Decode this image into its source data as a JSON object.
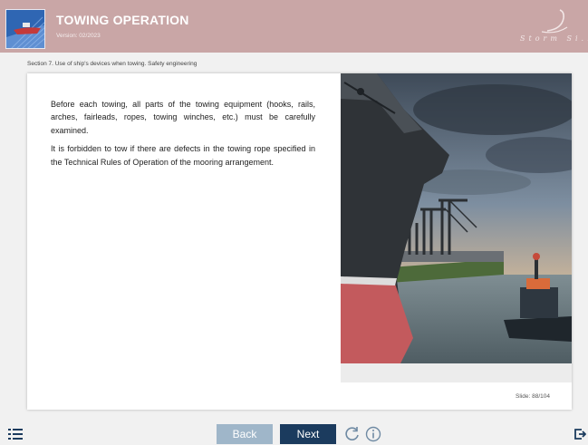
{
  "header": {
    "title": "TOWING OPERATION",
    "version": "Version: 02/2023",
    "brand_text": "Storm Si..."
  },
  "breadcrumb": "Section 7. Use of ship's devices when towing. Safety engineering",
  "content": {
    "paragraphs": [
      "Before each towing, all parts of the towing equipment (hooks, rails, arches, fairleads, ropes, towing winches, etc.) must be carefully examined.",
      "It is forbidden to tow if there are defects in the towing rope specified in the Technical Rules of Operation of the mooring arrangement."
    ]
  },
  "slide_counter": "Slide: 88/104",
  "nav": {
    "back_label": "Back",
    "next_label": "Next"
  },
  "icons": {
    "menu": "list-icon",
    "reload": "reload-icon",
    "info": "info-icon",
    "exit": "exit-icon"
  },
  "colors": {
    "header_bg": "#c9a6a6",
    "next_bg": "#1b3b5e",
    "back_bg": "#9fb6c9",
    "logo_bg": "#2f66b3"
  }
}
